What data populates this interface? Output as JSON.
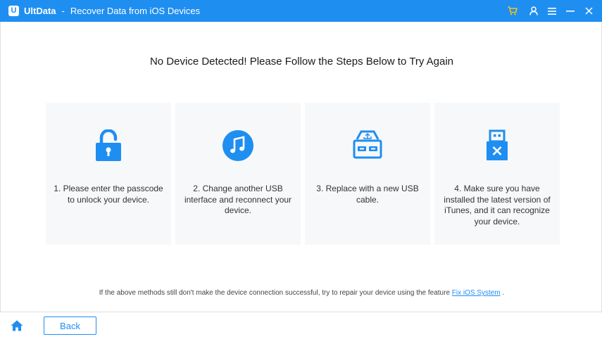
{
  "titlebar": {
    "logo_letter": "U",
    "app_name": "UltData",
    "separator": "-",
    "window_title": "Recover Data from iOS Devices",
    "icons": [
      "cart-icon",
      "user-icon",
      "menu-icon",
      "minimize-icon",
      "close-icon"
    ]
  },
  "main": {
    "heading": "No Device Detected! Please Follow the Steps Below to Try Again",
    "steps": [
      {
        "icon": "unlock-icon",
        "text": "1. Please enter the passcode to unlock your device."
      },
      {
        "icon": "itunes-icon",
        "text": "2. Change another USB interface and reconnect your device."
      },
      {
        "icon": "usb-port-icon",
        "text": "3. Replace with a new USB cable."
      },
      {
        "icon": "usb-error-icon",
        "text": "4. Make sure you have installed the latest version of iTunes, and it can recognize your device."
      }
    ],
    "footer_note_prefix": "If the above methods still don't make the device connection successful, try to repair your device using the feature",
    "footer_link": "Fix iOS System",
    "footer_note_suffix": "."
  },
  "bottombar": {
    "home_icon": "home-icon",
    "back_label": "Back"
  },
  "colors": {
    "accent": "#1f8ef1",
    "card_bg": "#f7f8fa"
  }
}
